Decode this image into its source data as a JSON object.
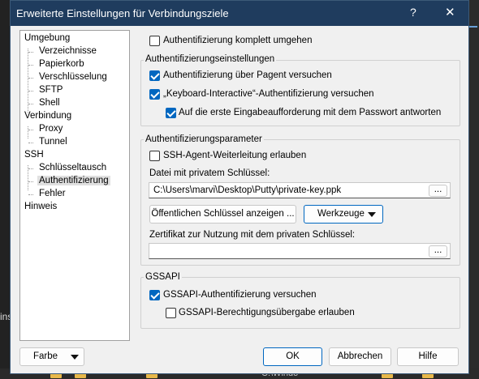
{
  "window": {
    "title": "Erweiterte Einstellungen für Verbindungsziele",
    "help_label": "?",
    "close_label": "✕"
  },
  "background": {
    "left_text": "ins",
    "taskbar_text": "C:\\Windo"
  },
  "tree": {
    "items": [
      {
        "label": "Umgebung",
        "level": 0
      },
      {
        "label": "Verzeichnisse",
        "level": 1
      },
      {
        "label": "Papierkorb",
        "level": 1
      },
      {
        "label": "Verschlüsselung",
        "level": 1
      },
      {
        "label": "SFTP",
        "level": 1
      },
      {
        "label": "Shell",
        "level": 1
      },
      {
        "label": "Verbindung",
        "level": 0
      },
      {
        "label": "Proxy",
        "level": 1
      },
      {
        "label": "Tunnel",
        "level": 1
      },
      {
        "label": "SSH",
        "level": 0
      },
      {
        "label": "Schlüsseltausch",
        "level": 1
      },
      {
        "label": "Authentifizierung",
        "level": 1,
        "selected": true
      },
      {
        "label": "Fehler",
        "level": 1
      },
      {
        "label": "Hinweis",
        "level": 0
      }
    ]
  },
  "bypass": {
    "label": "Authentifizierung komplett umgehen",
    "checked": false
  },
  "auth_settings": {
    "title": "Authentifizierungseinstellungen",
    "pageant": {
      "label": "Authentifizierung über Pagent versuchen",
      "checked": true
    },
    "keyboard": {
      "label": "„Keyboard-Interactive“-Authentifizierung versuchen",
      "checked": true
    },
    "respond": {
      "label": "Auf die erste Eingabeaufforderung mit dem Passwort antworten",
      "checked": true
    }
  },
  "auth_params": {
    "title": "Authentifizierungsparameter",
    "agent_fwd": {
      "label": "SSH-Agent-Weiterleitung erlauben",
      "checked": false
    },
    "key_file_label": "Datei mit privatem Schlüssel:",
    "key_file_value": "C:\\Users\\marvi\\Desktop\\Putty\\private-key.ppk",
    "browse_label": "...",
    "show_pubkey_label": "Öffentlichen Schlüssel anzeigen ...",
    "tools_label": "Werkzeuge",
    "cert_label": "Zertifikat zur Nutzung mit dem privaten Schlüssel:",
    "cert_value": "",
    "cert_browse_label": "..."
  },
  "gssapi": {
    "title": "GSSAPI",
    "try": {
      "label": "GSSAPI-Authentifizierung versuchen",
      "checked": true
    },
    "delegate": {
      "label": "GSSAPI-Berechtigungsübergabe erlauben",
      "checked": false
    }
  },
  "footer": {
    "color_label": "Farbe",
    "ok_label": "OK",
    "cancel_label": "Abbrechen",
    "help_label": "Hilfe"
  },
  "colors": {
    "accent": "#0067c0",
    "titlebar": "#1f3c5e"
  }
}
